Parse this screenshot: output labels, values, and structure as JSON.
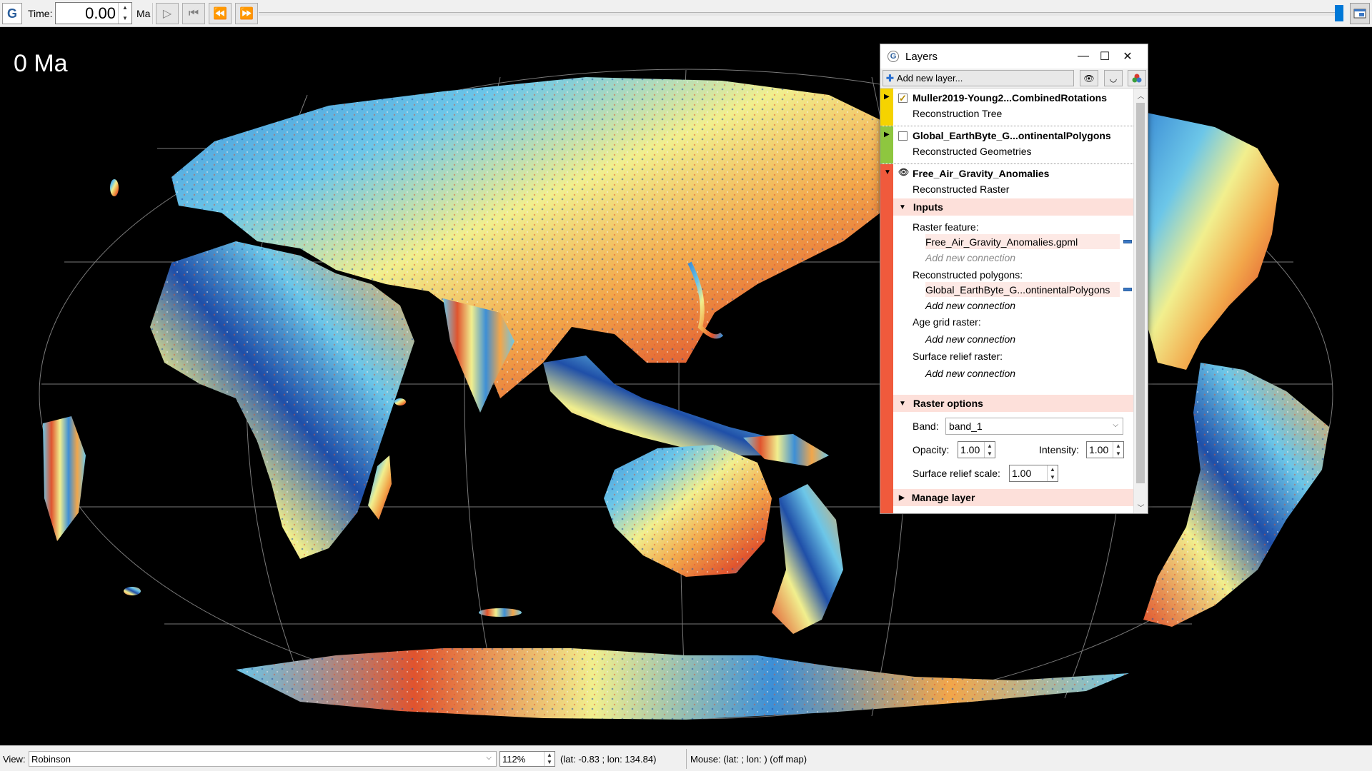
{
  "toolbar": {
    "app_icon": "gplates-logo",
    "time_label": "Time:",
    "time_value": "0.00",
    "time_unit": "Ma",
    "buttons": [
      "play-icon",
      "skip-to-start-icon",
      "step-back-icon",
      "step-forward-icon"
    ],
    "slider_position": 1.0
  },
  "viewport": {
    "time_overlay": "0 Ma",
    "projection_graticule": true,
    "raster_palette": [
      "#1f4fa8",
      "#3d8fd6",
      "#6cc6e8",
      "#f1ef8e",
      "#f2a64a",
      "#e0542e",
      "#f5f5f5"
    ]
  },
  "layers_window": {
    "title": "Layers",
    "add_layer_label": "Add new layer...",
    "layers": [
      {
        "name": "Muller2019-Young2...CombinedRotations",
        "type": "Reconstruction Tree",
        "color": "#f5d300",
        "checked": true,
        "expanded": false
      },
      {
        "name": "Global_EarthByte_G...ontinentalPolygons",
        "type": "Reconstructed Geometries",
        "color": "#8ec63f",
        "checked": false,
        "expanded": false
      },
      {
        "name": "Free_Air_Gravity_Anomalies",
        "type": "Reconstructed Raster",
        "color": "#f05a3c",
        "checked": true,
        "expanded": true,
        "inputs": {
          "heading": "Inputs",
          "raster_feature_label": "Raster feature:",
          "raster_feature_value": "Free_Air_Gravity_Anomalies.gpml",
          "raster_feature_add": "Add new connection",
          "polygons_label": "Reconstructed polygons:",
          "polygons_value": "Global_EarthByte_G...ontinentalPolygons",
          "polygons_add": "Add new connection",
          "age_grid_label": "Age grid raster:",
          "age_grid_add": "Add new connection",
          "surface_relief_label": "Surface relief raster:",
          "surface_relief_add": "Add new connection"
        },
        "raster_options": {
          "heading": "Raster options",
          "band_label": "Band:",
          "band_value": "band_1",
          "opacity_label": "Opacity:",
          "opacity_value": "1.00",
          "intensity_label": "Intensity:",
          "intensity_value": "1.00",
          "relief_scale_label": "Surface relief scale:",
          "relief_scale_value": "1.00"
        },
        "manage": {
          "heading": "Manage layer"
        }
      }
    ]
  },
  "statusbar": {
    "view_label": "View:",
    "view_value": "Robinson",
    "zoom_value": "112%",
    "latlon": "(lat: -0.83 ; lon: 134.84)",
    "mouse": "Mouse: (lat: ; lon: ) (off map)"
  }
}
